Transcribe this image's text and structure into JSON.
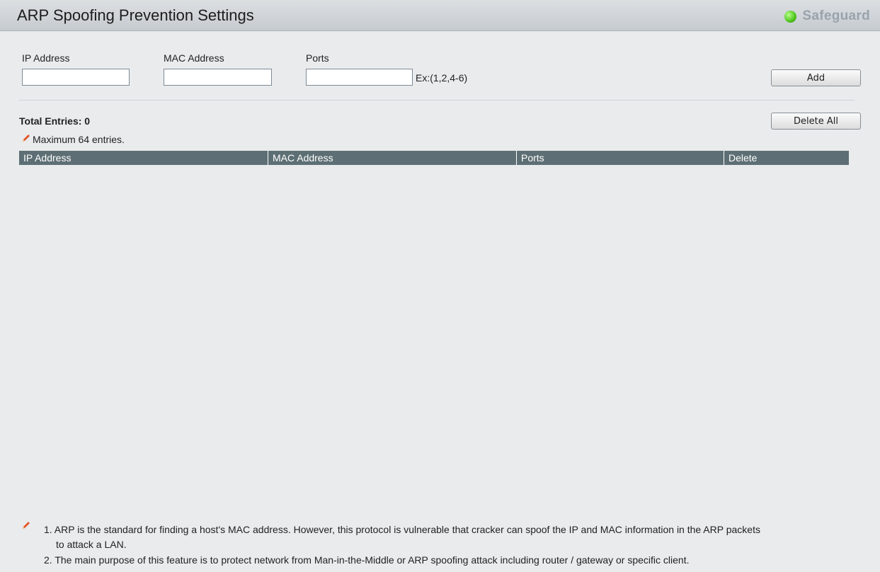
{
  "header": {
    "title": "ARP Spoofing Prevention Settings",
    "safeguard_label": "Safeguard",
    "safeguard_color": "#4cc31d"
  },
  "form": {
    "ip_label": "IP Address",
    "ip_value": "",
    "mac_label": "MAC Address",
    "mac_value": "",
    "ports_label": "Ports",
    "ports_value": "",
    "ports_hint": "Ex:(1,2,4-6)",
    "add_button": "Add"
  },
  "table": {
    "total_entries": "Total Entries: 0",
    "delete_all_button": "Delete All",
    "max_note": "Maximum 64 entries.",
    "columns": [
      "IP Address",
      "MAC Address",
      "Ports",
      "Delete"
    ],
    "rows": []
  },
  "notes": {
    "line1a": "1. ARP is the standard for finding a host's MAC address. However, this protocol is vulnerable that cracker can spoof the IP and MAC information in the ARP packets",
    "line1b": "to attack a LAN.",
    "line2": "2. The main purpose of this feature is to protect network from Man-in-the-Middle or ARP spoofing attack including router / gateway or specific client."
  },
  "colors": {
    "accent": "#5d6f74",
    "pencil": "#e2572a",
    "background": "#e9ebed"
  }
}
